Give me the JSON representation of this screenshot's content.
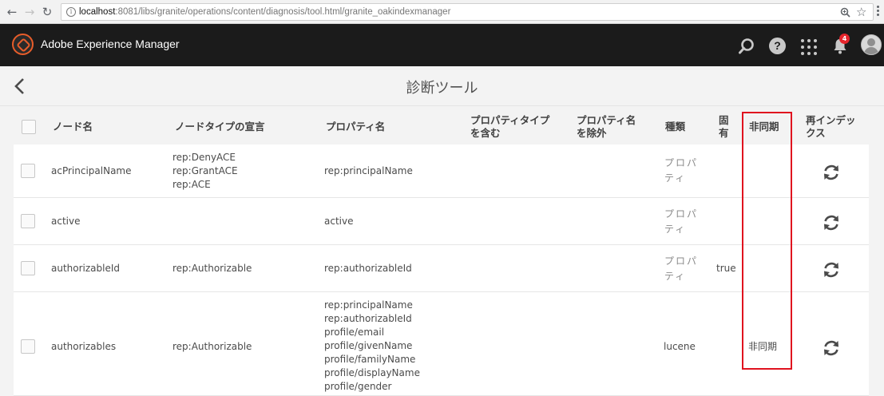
{
  "browser": {
    "url_host": "localhost",
    "url_path": ":8081/libs/granite/operations/content/diagnosis/tool.html/granite_oakindexmanager"
  },
  "shell": {
    "title": "Adobe Experience Manager",
    "notification_count": "4",
    "icons": [
      "search-icon",
      "help-icon",
      "apps-icon",
      "bell-icon",
      "avatar"
    ],
    "help_glyph": "?"
  },
  "page": {
    "title": "診断ツール"
  },
  "table": {
    "headers": {
      "node_name": "ノード名",
      "node_type": "ノードタイプの宣言",
      "property_name": "プロパティ名",
      "include_types_1": "プロパティタイプ",
      "include_types_2": "を含む",
      "exclude_names_1": "プロパティ名",
      "exclude_names_2": "を除外",
      "kind": "種類",
      "unique_1": "固",
      "unique_2": "有",
      "async": "非同期",
      "reindex_1": "再インデッ",
      "reindex_2": "クス"
    },
    "rows": [
      {
        "node_name": "acPrincipalName",
        "node_types": [
          "rep:DenyACE",
          "rep:GrantACE",
          "rep:ACE"
        ],
        "properties": [
          "rep:principalName"
        ],
        "kind_1": "プロパ",
        "kind_2": "ティ",
        "unique": "",
        "async": ""
      },
      {
        "node_name": "active",
        "node_types": [],
        "properties": [
          "active"
        ],
        "kind_1": "プロパ",
        "kind_2": "ティ",
        "unique": "",
        "async": ""
      },
      {
        "node_name": "authorizableId",
        "node_types": [
          "rep:Authorizable"
        ],
        "properties": [
          "rep:authorizableId"
        ],
        "kind_1": "プロパ",
        "kind_2": "ティ",
        "unique": "true",
        "async": ""
      },
      {
        "node_name": "authorizables",
        "node_types": [
          "rep:Authorizable"
        ],
        "properties": [
          "rep:principalName",
          "rep:authorizableId",
          "profile/email",
          "profile/givenName",
          "profile/familyName",
          "profile/displayName",
          "profile/gender"
        ],
        "kind_1": "lucene",
        "kind_2": "",
        "unique": "",
        "async": "非同期"
      }
    ]
  },
  "colors": {
    "shell_bg": "#1b1b1b",
    "accent": "#e85d2a",
    "highlight": "#e0121f",
    "badge": "#e5242b"
  }
}
